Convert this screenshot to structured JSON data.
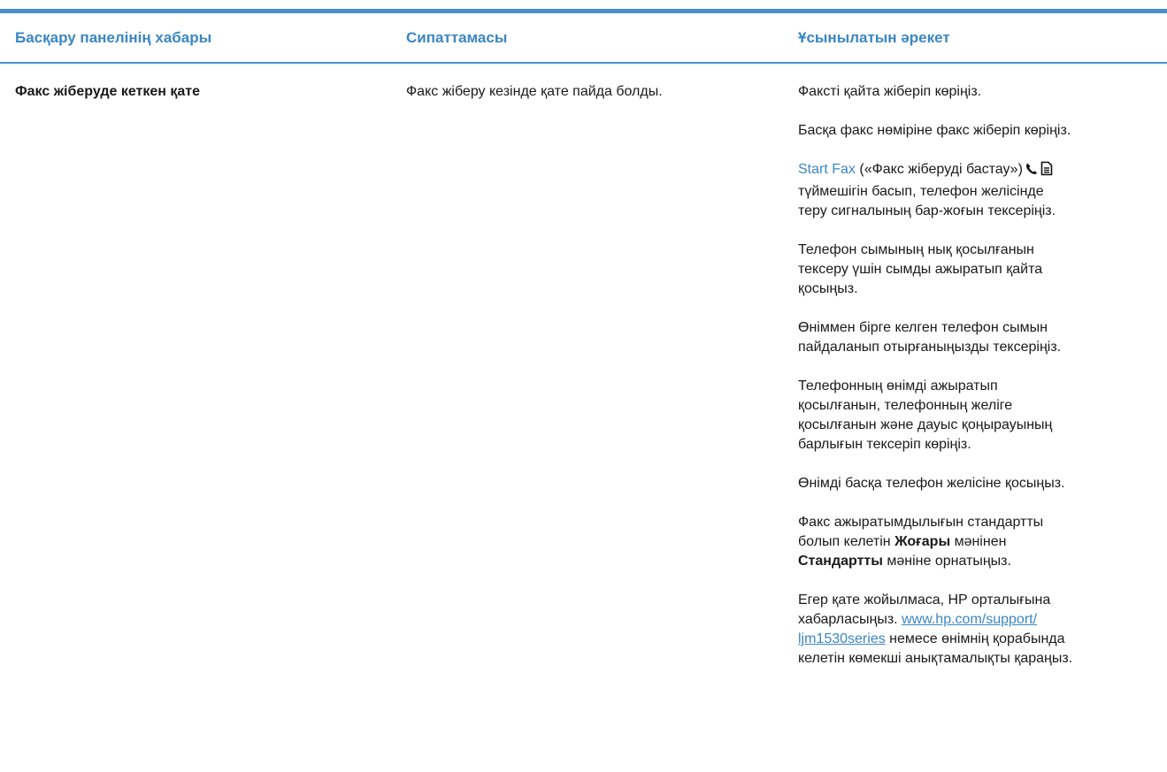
{
  "table": {
    "headers": {
      "col1": "Басқару панелінің хабары",
      "col2": "Сипаттамасы",
      "col3": "Ұсынылатын әрекет"
    },
    "row": {
      "message": "Факс жіберуде кеткен қате",
      "description": "Факс жіберу кезінде қате пайда болды.",
      "actions": {
        "a1": "Факсті қайта жіберіп көріңіз.",
        "a2": "Басқа факс нөміріне факс жіберіп көріңіз.",
        "a3_link": "Start Fax",
        "a3_paren": "(«Факс жіберуді бастау»)",
        "a3_line2": "түймешігін басып, телефон желісінде",
        "a3_line3": "теру сигналының бар-жоғын тексеріңіз.",
        "a4_line1": "Телефон сымының нық қосылғанын",
        "a4_line2": "тексеру үшін сымды ажыратып қайта",
        "a4_line3": "қосыңыз.",
        "a5_line1": "Өніммен бірге келген телефон сымын",
        "a5_line2": "пайдаланып отырғаныңызды тексеріңіз.",
        "a6_line1": "Телефонның өнімді ажыратып",
        "a6_line2": "қосылғанын, телефонның желіге",
        "a6_line3": "қосылғанын және дауыс қоңырауының",
        "a6_line4": "барлығын тексеріп көріңіз.",
        "a7": "Өнімді басқа телефон желісіне қосыңыз.",
        "a8_line1": "Факс ажыратымдылығын стандартты",
        "a8_line2_pre": "болып келетін",
        "a8_line2_bold": "Жоғары",
        "a8_line2_post": "мәнінен",
        "a8_line3_bold": "Стандартты",
        "a8_line3_post": "мәніне орнатыңыз.",
        "a9_line1": "Егер қате жойылмаса, HP орталығына",
        "a9_line2_pre": "хабарласыңыз.",
        "a9_link1": "www.hp.com/support/",
        "a9_link2": "ljm1530series",
        "a9_line3_post": "немесе өнімнің қорабында",
        "a9_line4": "келетін көмекші анықтамалықты қараңыз."
      }
    }
  },
  "colors": {
    "accent": "#3a86c4",
    "rule": "#4a90c8"
  },
  "icons": [
    "phone-icon",
    "document-icon"
  ]
}
